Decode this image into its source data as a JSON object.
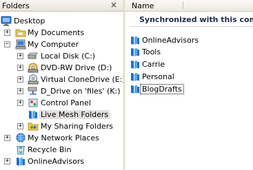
{
  "folders_pane": {
    "title": "Folders",
    "close_glyph": "×"
  },
  "tree": [
    {
      "label": "Desktop",
      "icon": "desktop-icon",
      "expander": ""
    },
    {
      "label": "My Documents",
      "icon": "folder-icon",
      "expander": "+"
    },
    {
      "label": "My Computer",
      "icon": "computer-icon",
      "expander": "−"
    },
    {
      "label": "Local Disk (C:)",
      "icon": "hard-disk-icon",
      "expander": "+"
    },
    {
      "label": "DVD-RW Drive (D:)",
      "icon": "dvd-drive-icon",
      "expander": "+"
    },
    {
      "label": "Virtual CloneDrive (E:)",
      "icon": "cd-drive-icon",
      "expander": "+"
    },
    {
      "label": "D_Drive on 'files' (K:)",
      "icon": "network-drive-icon",
      "expander": "+"
    },
    {
      "label": "Control Panel",
      "icon": "control-panel-icon",
      "expander": "+"
    },
    {
      "label": "Live Mesh Folders",
      "icon": "live-mesh-folder-icon",
      "expander": "",
      "selected": true
    },
    {
      "label": "My Sharing Folders",
      "icon": "sharing-folder-icon",
      "expander": "+"
    },
    {
      "label": "My Network Places",
      "icon": "network-places-icon",
      "expander": "+"
    },
    {
      "label": "Recycle Bin",
      "icon": "recycle-bin-icon",
      "expander": ""
    },
    {
      "label": "OnlineAdvisors",
      "icon": "live-mesh-folder-icon",
      "expander": "+"
    }
  ],
  "details": {
    "column_name": "Name",
    "banner": "Synchronized with this computer",
    "items": [
      {
        "label": "OnlineAdvisors",
        "icon": "live-mesh-folder-icon"
      },
      {
        "label": "Tools",
        "icon": "live-mesh-folder-icon"
      },
      {
        "label": "Carrie",
        "icon": "live-mesh-folder-icon"
      },
      {
        "label": "Personal",
        "icon": "live-mesh-folder-icon"
      },
      {
        "label": "BlogDrafts",
        "icon": "live-mesh-folder-icon",
        "focused": true
      }
    ]
  },
  "colors": {
    "mesh_blue": "#1f6fd1",
    "folder_yellow": "#f2c94c",
    "selection": "#e2e0dc"
  }
}
